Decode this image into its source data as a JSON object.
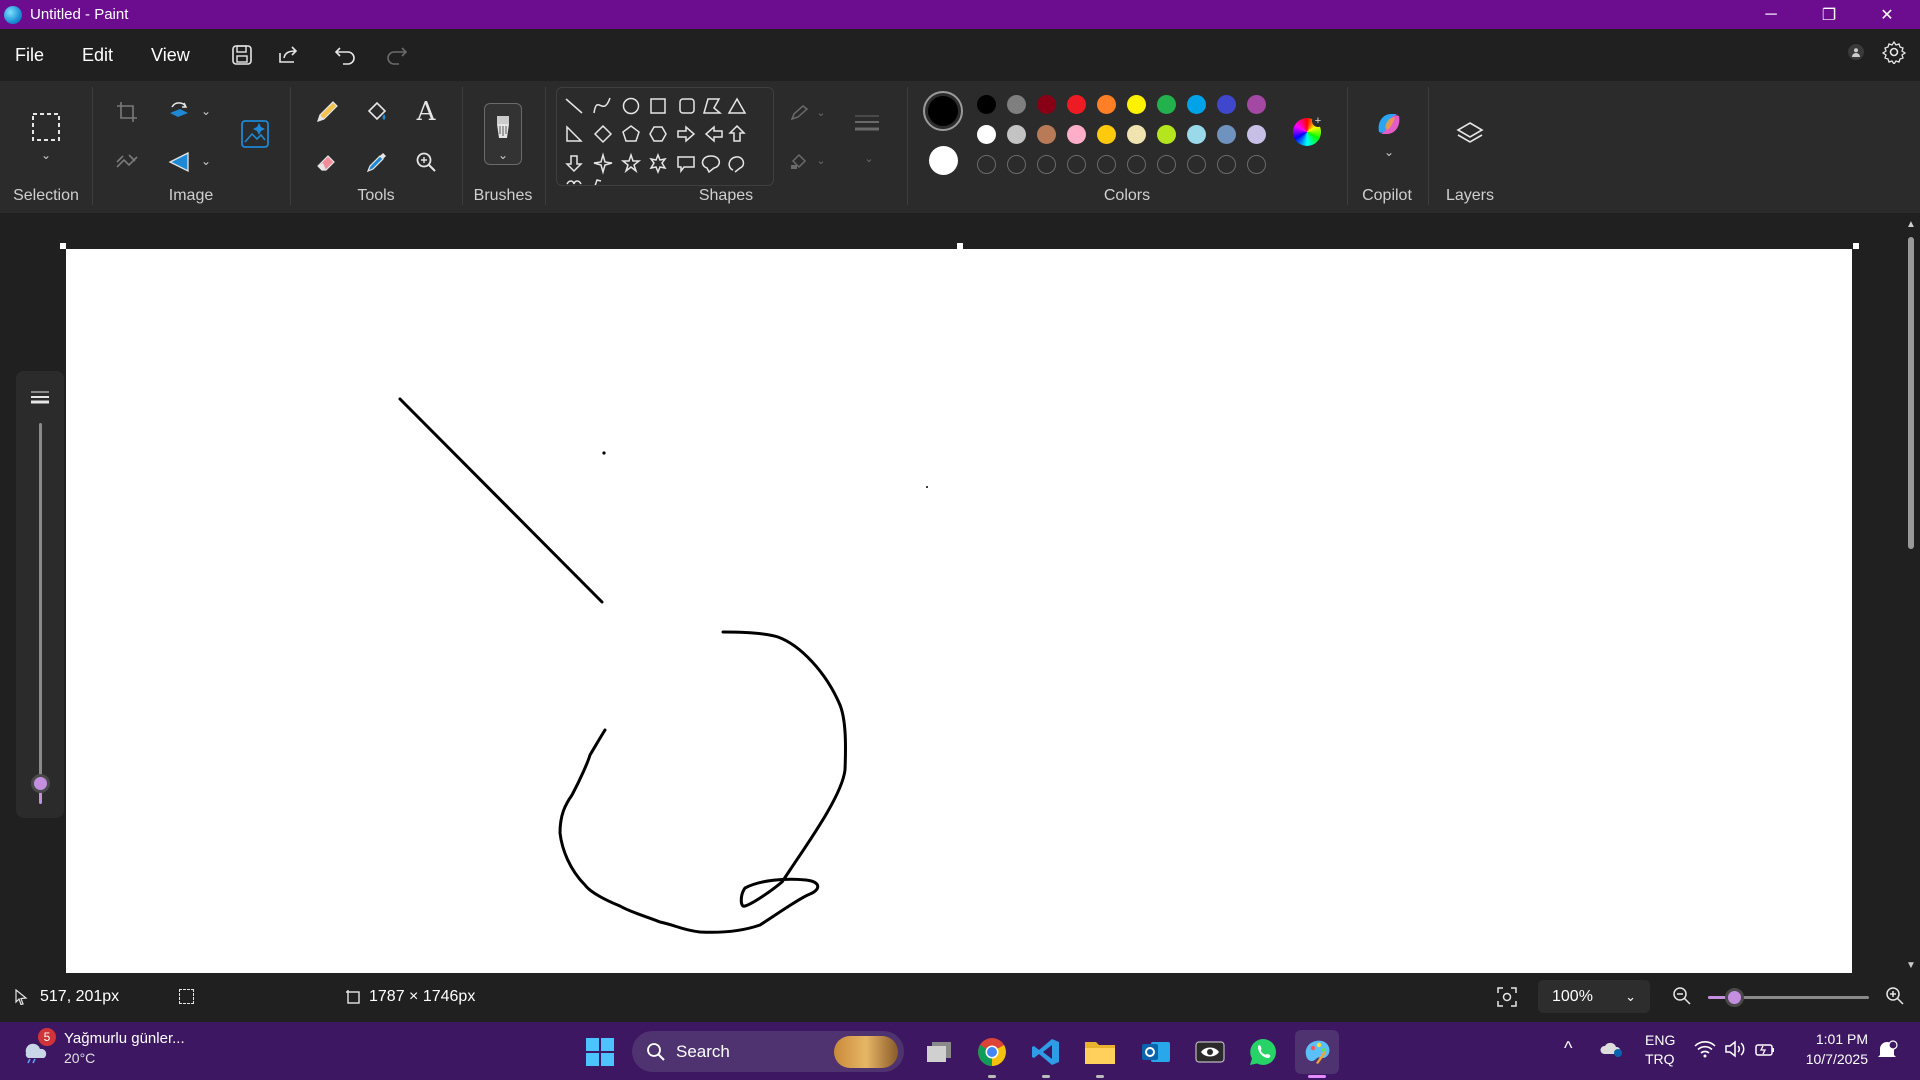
{
  "window": {
    "title": "Untitled - Paint",
    "minimize": "─",
    "restore": "❐",
    "close": "✕"
  },
  "menu": {
    "file": "File",
    "edit": "Edit",
    "view": "View"
  },
  "ribbon": {
    "selection": "Selection",
    "image": "Image",
    "tools": "Tools",
    "brushes": "Brushes",
    "shapes": "Shapes",
    "colors": "Colors",
    "copilot": "Copilot",
    "layers": "Layers"
  },
  "palette": {
    "primary": "#000000",
    "secondary": "#ffffff",
    "row1": [
      "#000000",
      "#7f7f7f",
      "#880015",
      "#ed1c24",
      "#ff7f27",
      "#fff200",
      "#22b14c",
      "#00a2e8",
      "#3f48cc",
      "#a349a4"
    ],
    "row2": [
      "#ffffff",
      "#c3c3c3",
      "#b97a57",
      "#ffaec9",
      "#ffc90e",
      "#efe4b0",
      "#b5e61d",
      "#99d9ea",
      "#7092be",
      "#c8bfe7"
    ]
  },
  "status": {
    "cursor": "517, 201px",
    "canvas_size": "1787 × 1746px",
    "zoom": "100%"
  },
  "taskbar": {
    "weather_badge": "5",
    "weather_title": "Yağmurlu günler...",
    "weather_temp": "20°C",
    "search": "Search",
    "lang1": "ENG",
    "lang2": "TRQ",
    "time": "1:01 PM",
    "date": "10/7/2025"
  }
}
